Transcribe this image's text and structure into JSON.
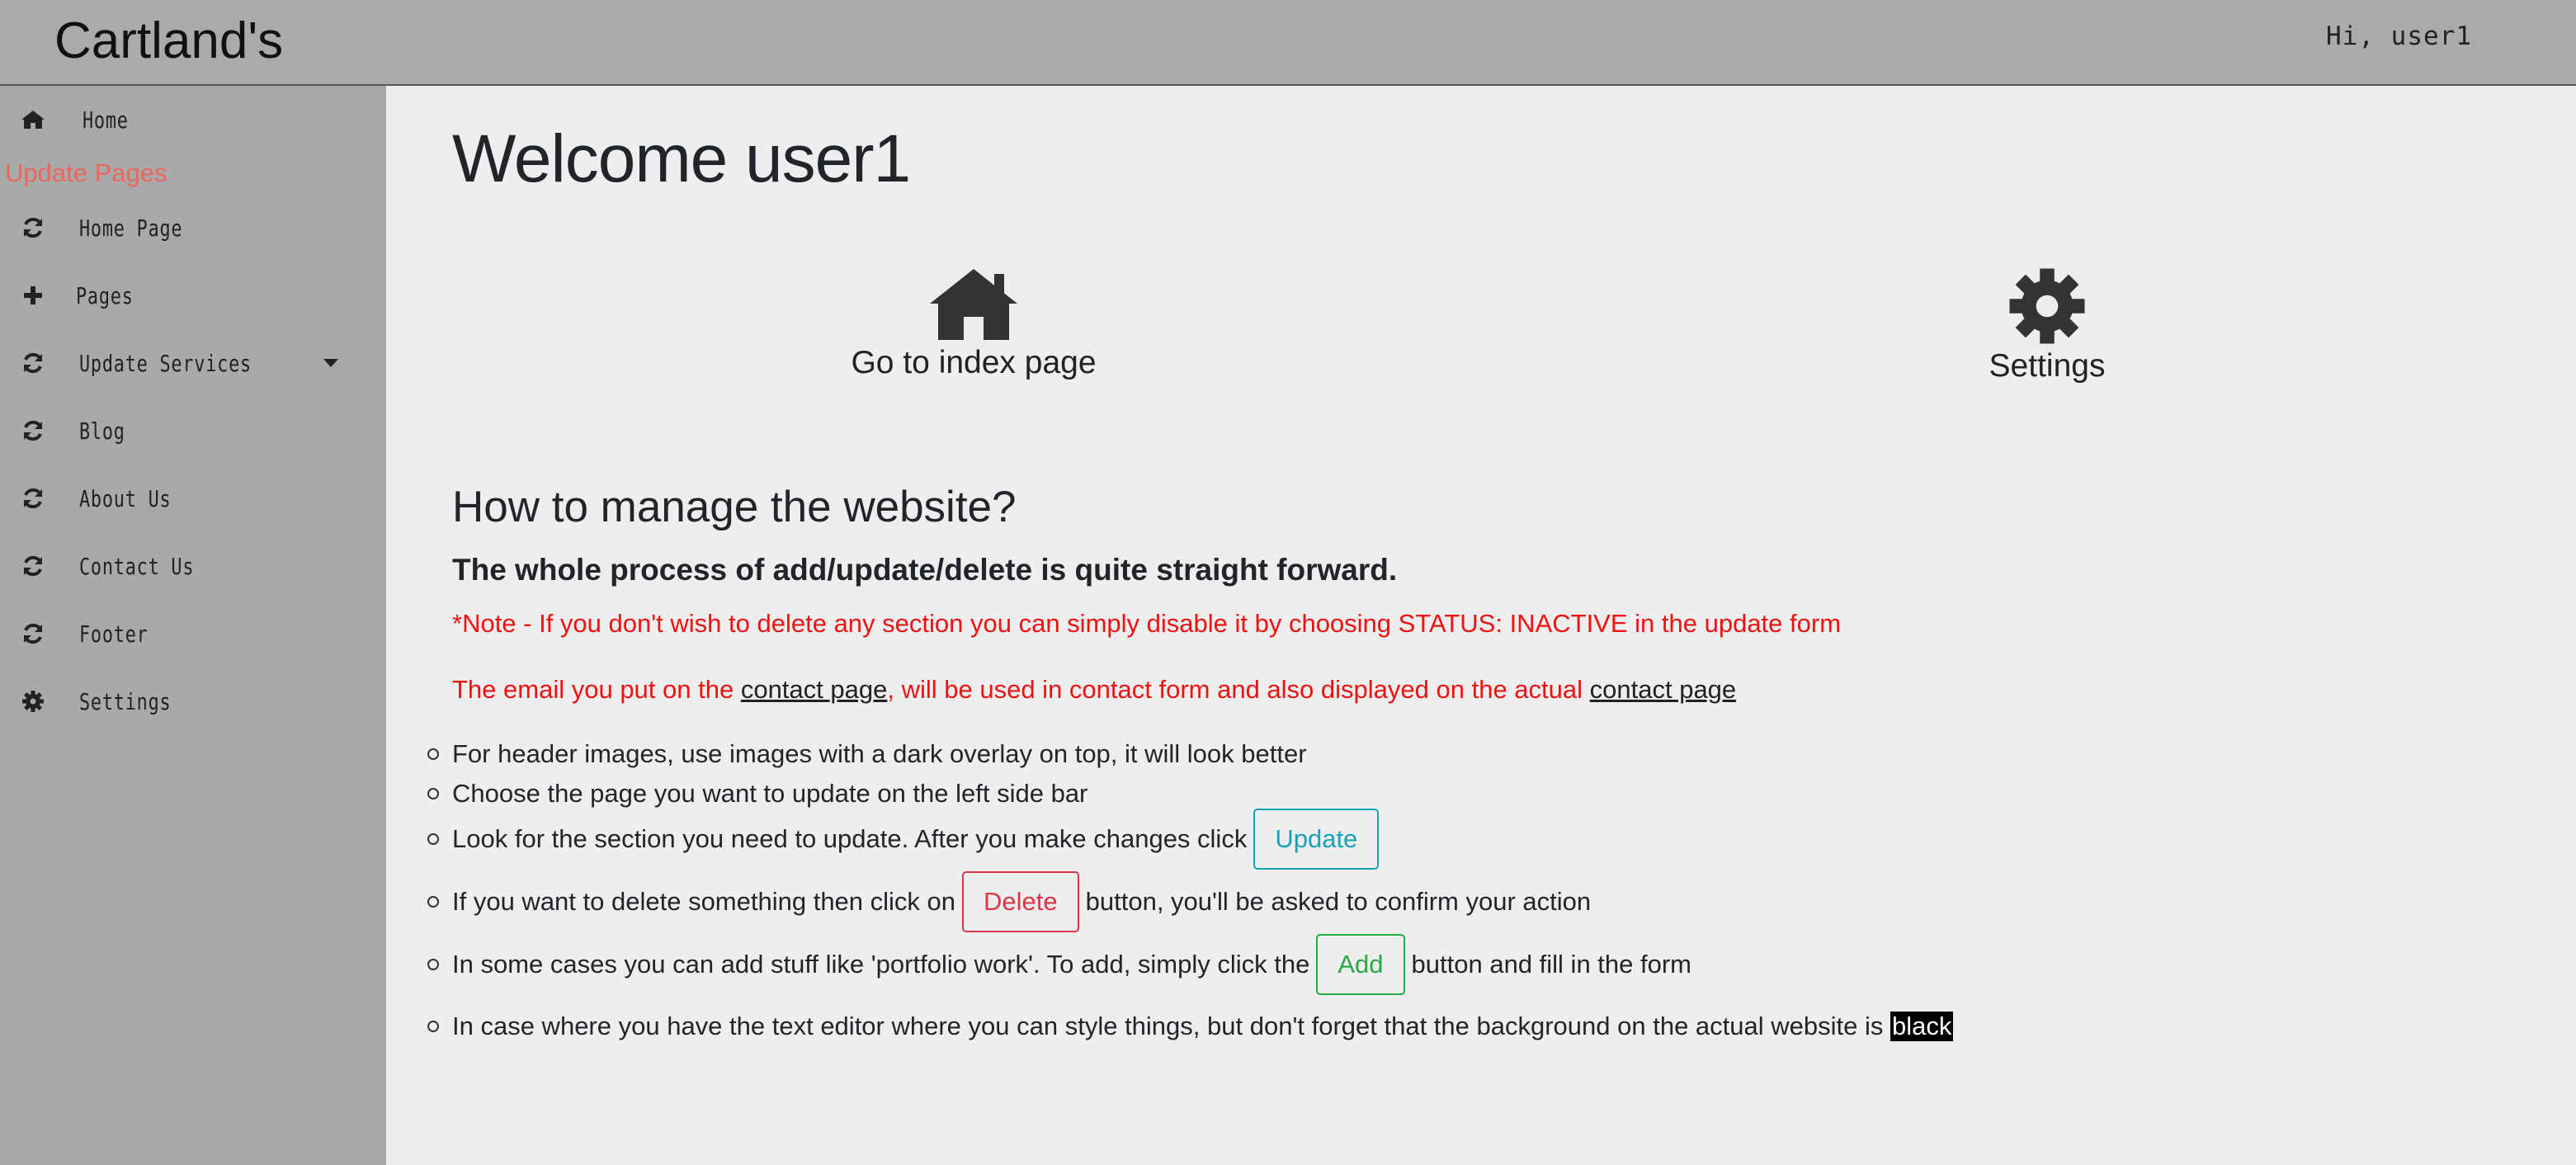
{
  "header": {
    "brand": "Cartland's",
    "greeting": "Hi, user1"
  },
  "sidebar": {
    "section_heading": "Update Pages",
    "items": [
      {
        "label": "Home",
        "icon": "home-icon"
      },
      {
        "label": "Home Page",
        "icon": "refresh-icon"
      },
      {
        "label": "Pages",
        "icon": "plus-icon"
      },
      {
        "label": "Update Services",
        "icon": "refresh-icon",
        "has_dropdown": true
      },
      {
        "label": "Blog",
        "icon": "refresh-icon"
      },
      {
        "label": "About Us",
        "icon": "refresh-icon"
      },
      {
        "label": "Contact Us",
        "icon": "refresh-icon"
      },
      {
        "label": "Footer",
        "icon": "refresh-icon"
      },
      {
        "label": "Settings",
        "icon": "gear-icon"
      }
    ]
  },
  "main": {
    "welcome": "Welcome user1",
    "cards": [
      {
        "label": "Go to index page",
        "icon": "home-icon"
      },
      {
        "label": "Settings",
        "icon": "gear-icon"
      }
    ],
    "heading": "How to manage the website?",
    "subheading": "The whole process of add/update/delete is quite straight forward.",
    "note": "*Note - If you don't wish to delete any section you can simply disable it by choosing STATUS: INACTIVE in the update form",
    "email_note": {
      "part1": "The email you put on the ",
      "link1": "contact page",
      "part2": ", will be used in contact form and also displayed on the actual ",
      "link2": "contact page"
    },
    "tips": {
      "tip1": "For header images, use images with a dark overlay on top, it will look better",
      "tip2": "Choose the page you want to update on the left side bar",
      "tip3_before": "Look for the section you need to update. After you make changes click",
      "update_button": "Update",
      "tip4_before": "If you want to delete something then click on",
      "delete_button": "Delete",
      "tip4_after": "button, you'll be asked to confirm your action",
      "tip5_before": "In some cases you can add stuff like 'portfolio work'. To add, simply click the",
      "add_button": "Add",
      "tip5_after": "button and fill in the form",
      "tip6_before": "In case where you have the text editor where you can style things, but don't forget that the background on the actual website is",
      "tip6_highlight": "black"
    }
  },
  "colors": {
    "header_bg": "#aaaaaa",
    "sidebar_bg": "#a9a9a9",
    "main_bg": "#eeeeee",
    "accent_red": "#ee1111",
    "sidebar_heading": "#e8685e",
    "update_btn": "#17a2b8",
    "delete_btn": "#dc3545",
    "add_btn": "#28a745"
  }
}
